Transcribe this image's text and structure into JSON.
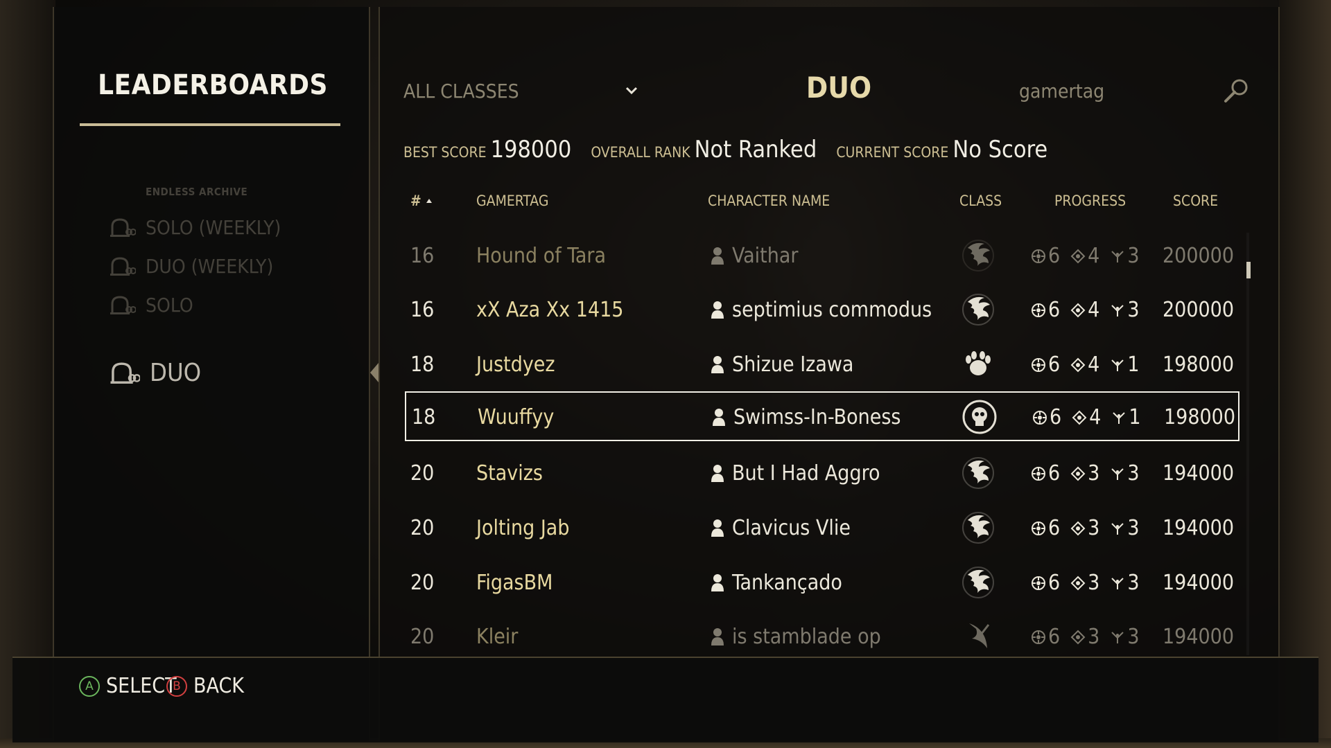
{
  "leaderboards_title": "LEADERBOARDS",
  "sidebar": {
    "section_label": "ENDLESS ARCHIVE",
    "items": [
      {
        "label": "SOLO (WEEKLY)",
        "active": false
      },
      {
        "label": "DUO (WEEKLY)",
        "active": false
      },
      {
        "label": "SOLO",
        "active": false
      },
      {
        "label": "DUO",
        "active": true
      }
    ]
  },
  "header": {
    "class_filter": "ALL CLASSES",
    "board_title": "DUO",
    "search_placeholder": "gamertag"
  },
  "stats": {
    "best_score_label": "BEST SCORE",
    "best_score_value": "198000",
    "overall_rank_label": "OVERALL RANK",
    "overall_rank_value": "Not Ranked",
    "current_score_label": "CURRENT SCORE",
    "current_score_value": "No Score"
  },
  "table": {
    "columns": {
      "rank": "#",
      "gamertag": "GAMERTAG",
      "character": "CHARACTER NAME",
      "class": "CLASS",
      "progress": "PROGRESS",
      "score": "SCORE"
    },
    "rows": [
      {
        "rank": "16",
        "gamertag": "Hound of Tara",
        "character": "Vaithar",
        "class_icon": "dragonknight-icon",
        "cycle": "6",
        "arc": "4",
        "stage": "3",
        "score": "200000",
        "dim": true,
        "selected": false
      },
      {
        "rank": "16",
        "gamertag": "xX Aza Xx 1415",
        "character": "septimius commodus",
        "class_icon": "dragonknight-icon",
        "cycle": "6",
        "arc": "4",
        "stage": "3",
        "score": "200000",
        "dim": false,
        "selected": false
      },
      {
        "rank": "18",
        "gamertag": "Justdyez",
        "character": "Shizue Izawa",
        "class_icon": "warden-icon",
        "cycle": "6",
        "arc": "4",
        "stage": "1",
        "score": "198000",
        "dim": false,
        "selected": false
      },
      {
        "rank": "18",
        "gamertag": "Wuuffyy",
        "character": "Swimss-In-Boness",
        "class_icon": "necromancer-icon",
        "cycle": "6",
        "arc": "4",
        "stage": "1",
        "score": "198000",
        "dim": false,
        "selected": true
      },
      {
        "rank": "20",
        "gamertag": "Stavizs",
        "character": "But I Had Aggro",
        "class_icon": "dragonknight-icon",
        "cycle": "6",
        "arc": "3",
        "stage": "3",
        "score": "194000",
        "dim": false,
        "selected": false
      },
      {
        "rank": "20",
        "gamertag": "Jolting Jab",
        "character": "Clavicus Vlie",
        "class_icon": "dragonknight-icon",
        "cycle": "6",
        "arc": "3",
        "stage": "3",
        "score": "194000",
        "dim": false,
        "selected": false
      },
      {
        "rank": "20",
        "gamertag": "FigasBM",
        "character": "Tankançado",
        "class_icon": "dragonknight-icon",
        "cycle": "6",
        "arc": "3",
        "stage": "3",
        "score": "194000",
        "dim": false,
        "selected": false
      },
      {
        "rank": "20",
        "gamertag": "Kleir",
        "character": "is stamblade op",
        "class_icon": "nightblade-icon",
        "cycle": "6",
        "arc": "3",
        "stage": "3",
        "score": "194000",
        "dim": true,
        "selected": false
      }
    ]
  },
  "footer": {
    "select_glyph": "A",
    "select_label": "SELECT",
    "back_glyph": "B",
    "back_label": "BACK"
  }
}
